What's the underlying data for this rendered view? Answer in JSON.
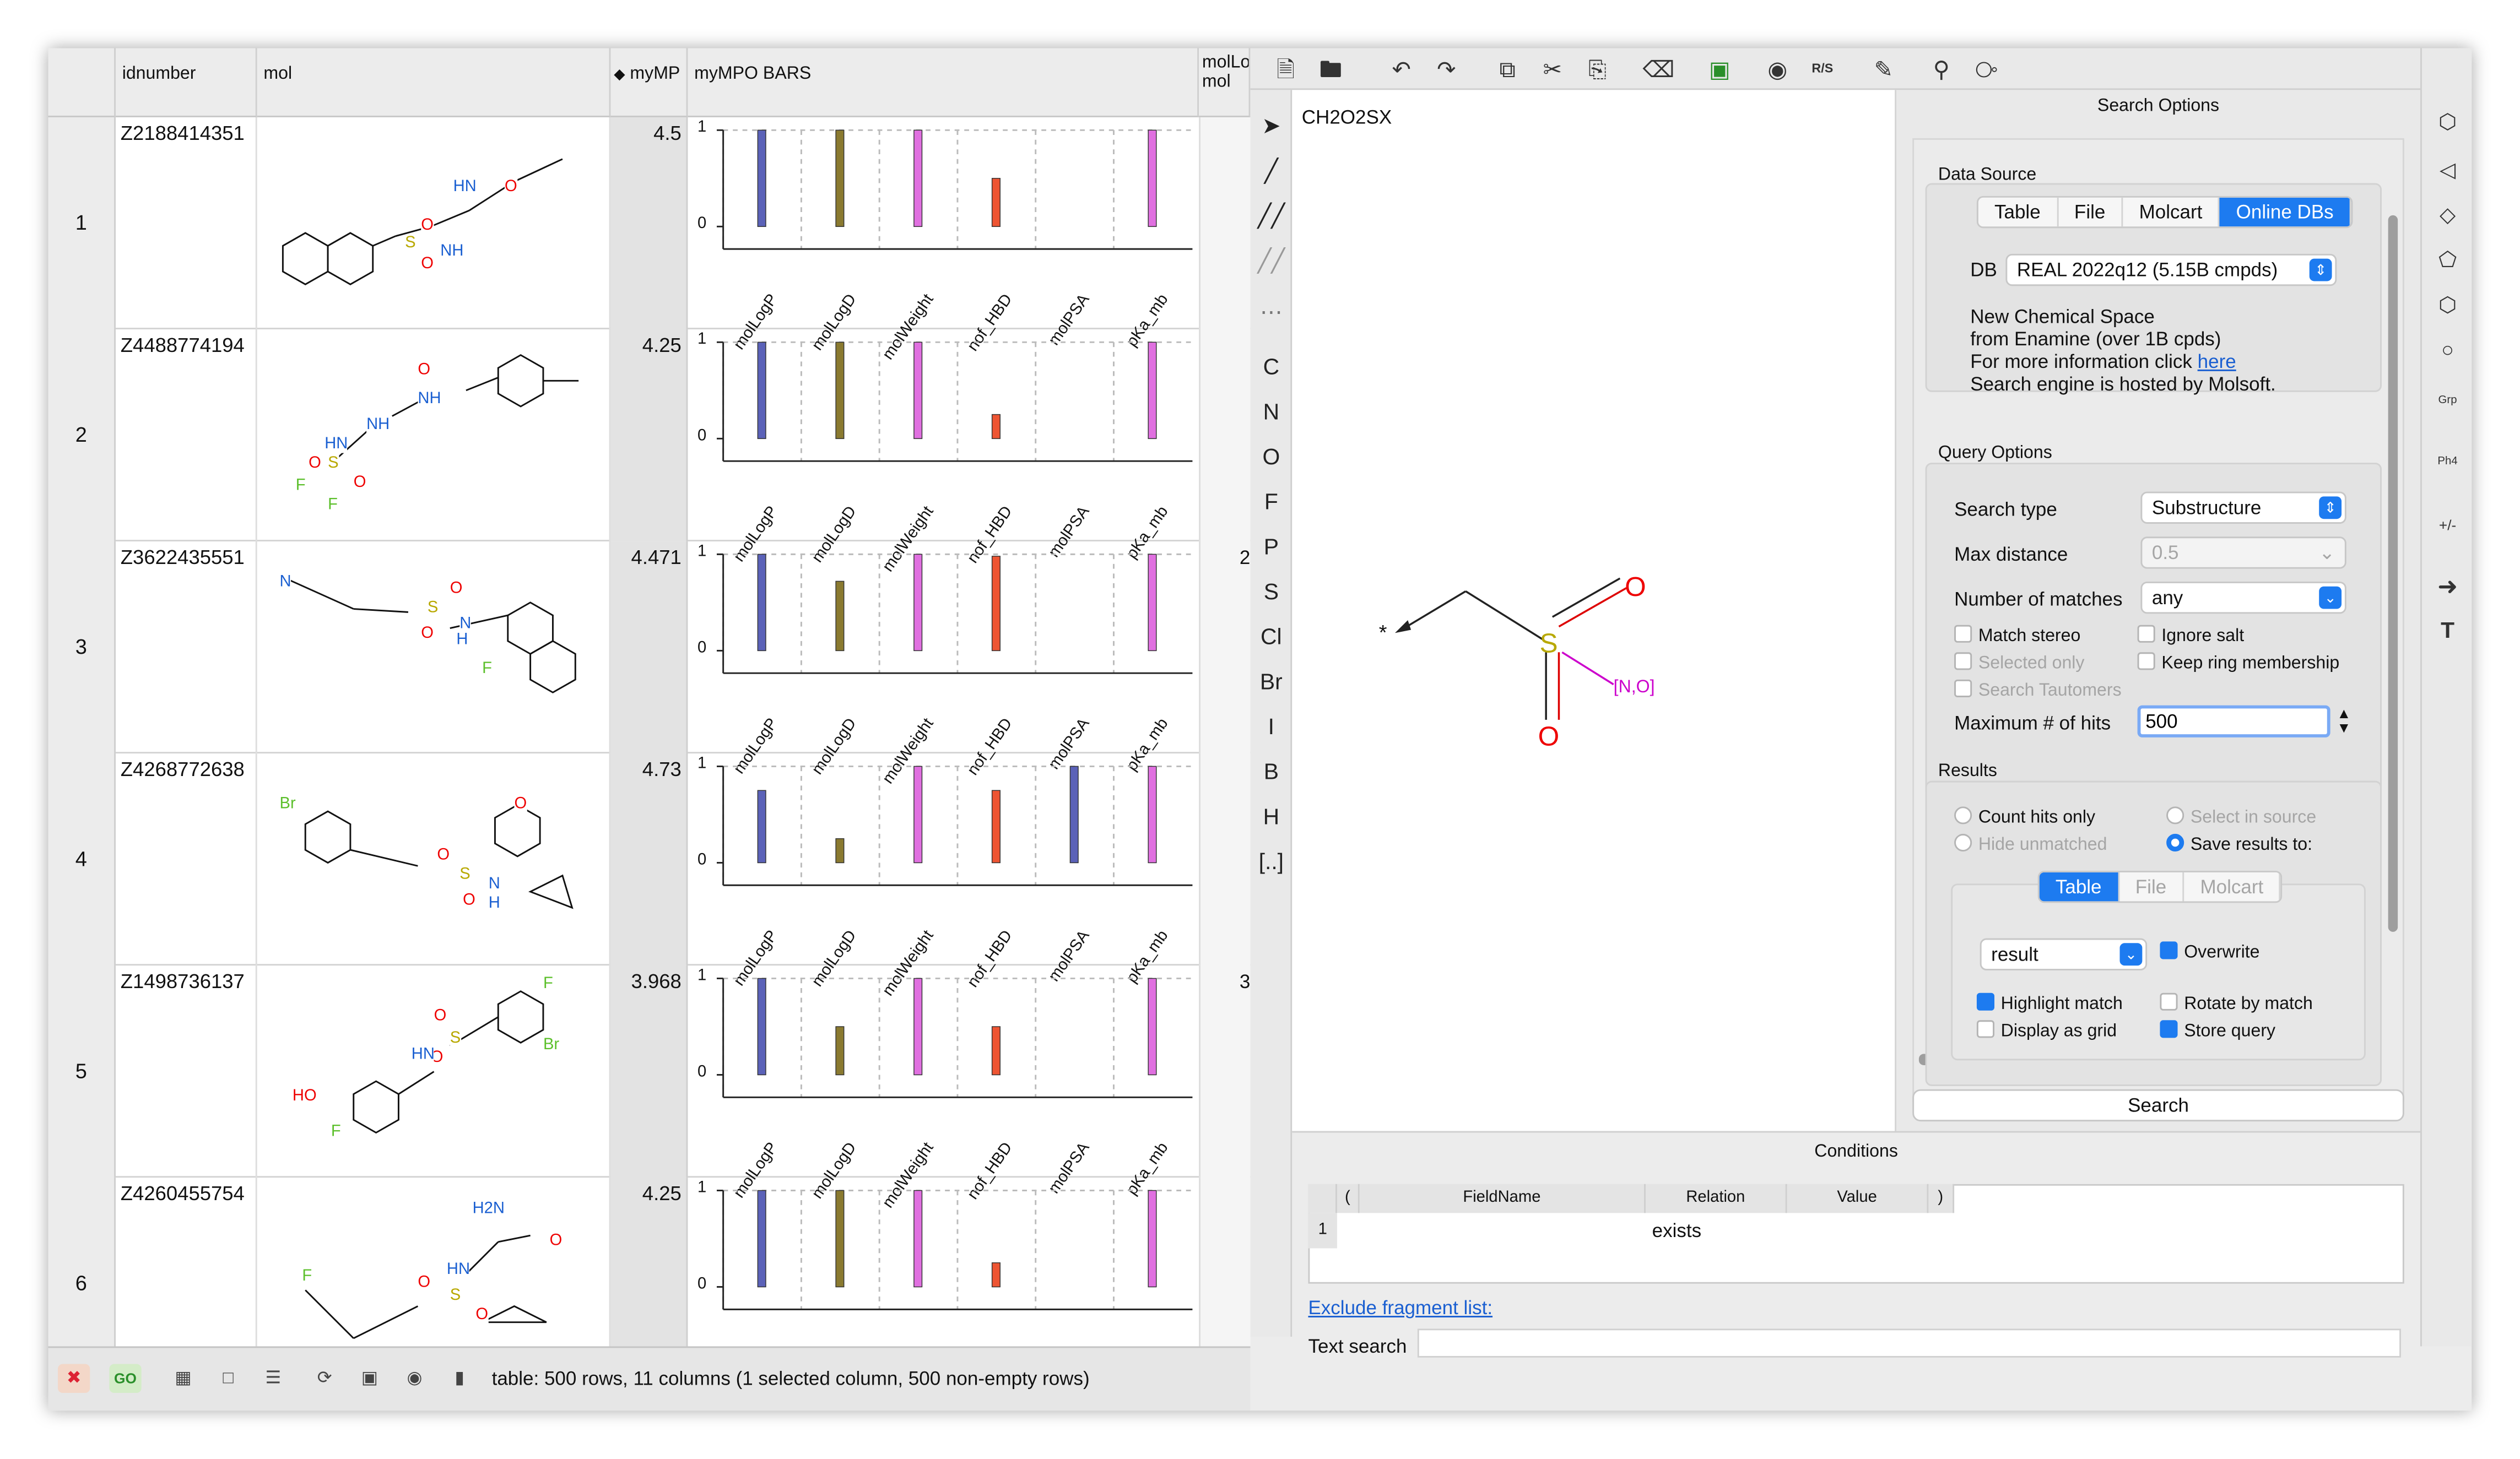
{
  "table": {
    "headers": {
      "idnumber": "idnumber",
      "mol": "mol",
      "mympo": "myMP",
      "mympo_bars": "myMPO BARS",
      "mollo": "molLo\nmol"
    },
    "bar_labels": [
      "molLogP",
      "molLogD",
      "molWeight",
      "nof_HBD",
      "molPSA",
      "pKa_mb"
    ],
    "rows": [
      {
        "n": "1",
        "id": "Z2188414351",
        "mpo": "4.5",
        "last": "",
        "vals": [
          1,
          1,
          1,
          0.5,
          0,
          1
        ]
      },
      {
        "n": "2",
        "id": "Z4488774194",
        "mpo": "4.25",
        "last": "",
        "vals": [
          1,
          1,
          1,
          0.25,
          0,
          1
        ]
      },
      {
        "n": "3",
        "id": "Z3622435551",
        "mpo": "4.471",
        "last": "2",
        "vals": [
          1,
          0.72,
          1,
          0.98,
          0,
          1
        ]
      },
      {
        "n": "4",
        "id": "Z4268772638",
        "mpo": "4.73",
        "last": "",
        "vals": [
          0.75,
          0.25,
          1,
          0.75,
          1,
          1
        ]
      },
      {
        "n": "5",
        "id": "Z1498736137",
        "mpo": "3.968",
        "last": "3",
        "vals": [
          1,
          0.5,
          1,
          0.5,
          0,
          1
        ]
      },
      {
        "n": "6",
        "id": "Z4260455754",
        "mpo": "4.25",
        "last": "",
        "vals": [
          1,
          1,
          1,
          0.25,
          0,
          1
        ]
      }
    ],
    "axis_labels": {
      "top": "1",
      "zero": "0"
    },
    "atoms": {
      "r1": [
        "HN",
        "O",
        "O",
        "S",
        "NH",
        "O"
      ],
      "r2": [
        "O",
        "NH",
        "NH",
        "HN",
        "S",
        "O",
        "O",
        "F",
        "F"
      ],
      "r3": [
        "N",
        "S",
        "O",
        "O",
        "N",
        "H",
        "F"
      ],
      "r4": [
        "Br",
        "O",
        "S",
        "O",
        "O",
        "N",
        "H"
      ],
      "r5": [
        "F",
        "O",
        "O",
        "S",
        "HN",
        "Br",
        "HO",
        "F"
      ],
      "r6": [
        "H2N",
        "O",
        "HN",
        "S",
        "O",
        "O",
        "F"
      ]
    }
  },
  "bottom": {
    "status": "table: 500 rows, 11 columns (1 selected column, 500 non-empty rows)",
    "go": "GO"
  },
  "editor": {
    "formula": "CH2O2SX",
    "atoms": {
      "star": "*",
      "s": "S",
      "o1": "O",
      "o2": "O",
      "no": "[N,O]"
    },
    "elements": [
      "C",
      "N",
      "O",
      "F",
      "P",
      "S",
      "Cl",
      "Br",
      "I",
      "B",
      "H",
      "[..]"
    ],
    "top_text": "R/S",
    "right_labels": {
      "grp": "Grp",
      "ph4": "Ph4",
      "pm": "+/-",
      "t": "T"
    }
  },
  "search": {
    "title": "Search Options",
    "data_source": {
      "title": "Data Source",
      "tabs": [
        "Table",
        "File",
        "Molcart",
        "Online DBs"
      ],
      "active": 3,
      "db_label": "DB",
      "db_value": "REAL 2022q12 (5.15B cmpds)",
      "desc1": "New Chemical Space",
      "desc2": "from Enamine (over 1B cpds)",
      "desc3": "For more information click ",
      "link": "here",
      "desc4": "Search engine is hosted by Molsoft."
    },
    "query": {
      "title": "Query Options",
      "search_type_label": "Search type",
      "search_type": "Substructure",
      "max_dist_label": "Max distance",
      "max_dist": "0.5",
      "num_matches_label": "Number of matches",
      "num_matches": "any",
      "match_stereo": "Match stereo",
      "ignore_salt": "Ignore salt",
      "selected_only": "Selected only",
      "keep_ring": "Keep ring membership",
      "tautomers": "Search Tautomers",
      "max_hits_label": "Maximum # of hits",
      "max_hits": "500"
    },
    "results": {
      "title": "Results",
      "count_hits": "Count hits only",
      "select_in_source": "Select in source",
      "hide_unmatched": "Hide unmatched",
      "save_results": "Save results to:",
      "tabs": [
        "Table",
        "File",
        "Molcart"
      ],
      "active": 0,
      "result_name": "result",
      "overwrite": "Overwrite",
      "highlight": "Highlight match",
      "rotate": "Rotate by match",
      "grid": "Display as grid",
      "store": "Store query"
    },
    "button": "Search"
  },
  "conditions": {
    "title": "Conditions",
    "cols": [
      "(",
      "FieldName",
      "Relation",
      "Value",
      ")"
    ],
    "row_num": "1",
    "relation": "exists",
    "exclude": "Exclude fragment list:",
    "text_search": "Text search"
  }
}
